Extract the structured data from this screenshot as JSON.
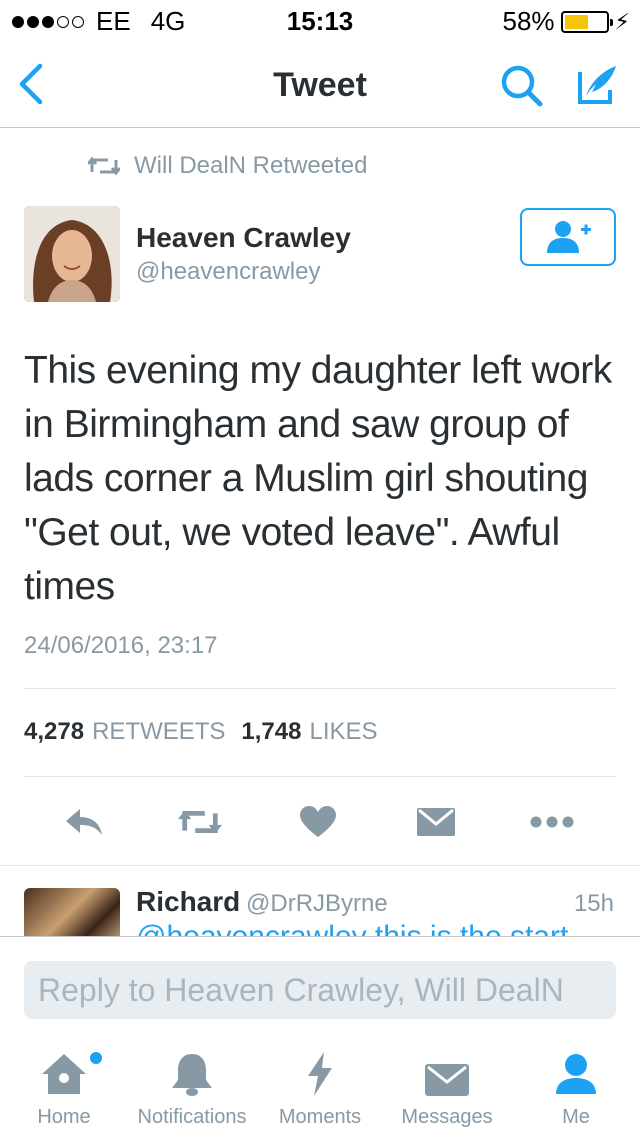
{
  "status_bar": {
    "carrier": "EE",
    "network": "4G",
    "time": "15:13",
    "battery": "58%",
    "battery_level": 0.58,
    "battery_color": "#f5c50a"
  },
  "nav": {
    "title": "Tweet"
  },
  "retweet_context": {
    "text": "Will DealN Retweeted"
  },
  "tweet": {
    "author_name": "Heaven Crawley",
    "author_handle": "@heavencrawley",
    "text": "This evening my daughter left work in Birmingham and saw group of lads corner a Muslim girl shouting \"Get out, we voted leave\". Awful times",
    "timestamp": "24/06/2016, 23:17",
    "retweets_count": "4,278",
    "retweets_label": "RETWEETS",
    "likes_count": "1,748",
    "likes_label": "LIKES"
  },
  "reply_preview": {
    "name": "Richard",
    "handle": "@DrRJByrne",
    "time": "15h",
    "text_peek": "@heavencrawley this is the start"
  },
  "composer": {
    "placeholder": "Reply to Heaven Crawley, Will DealN"
  },
  "tabs": [
    {
      "label": "Home",
      "icon": "home-icon",
      "active": false,
      "has_dot": true
    },
    {
      "label": "Notifications",
      "icon": "bell-icon",
      "active": false
    },
    {
      "label": "Moments",
      "icon": "lightning-icon",
      "active": false
    },
    {
      "label": "Messages",
      "icon": "envelope-icon",
      "active": false
    },
    {
      "label": "Me",
      "icon": "person-icon",
      "active": true
    }
  ],
  "colors": {
    "accent": "#1da1f2",
    "muted": "#8899a6",
    "text": "#292f33",
    "icon_gray": "#8899a6"
  }
}
